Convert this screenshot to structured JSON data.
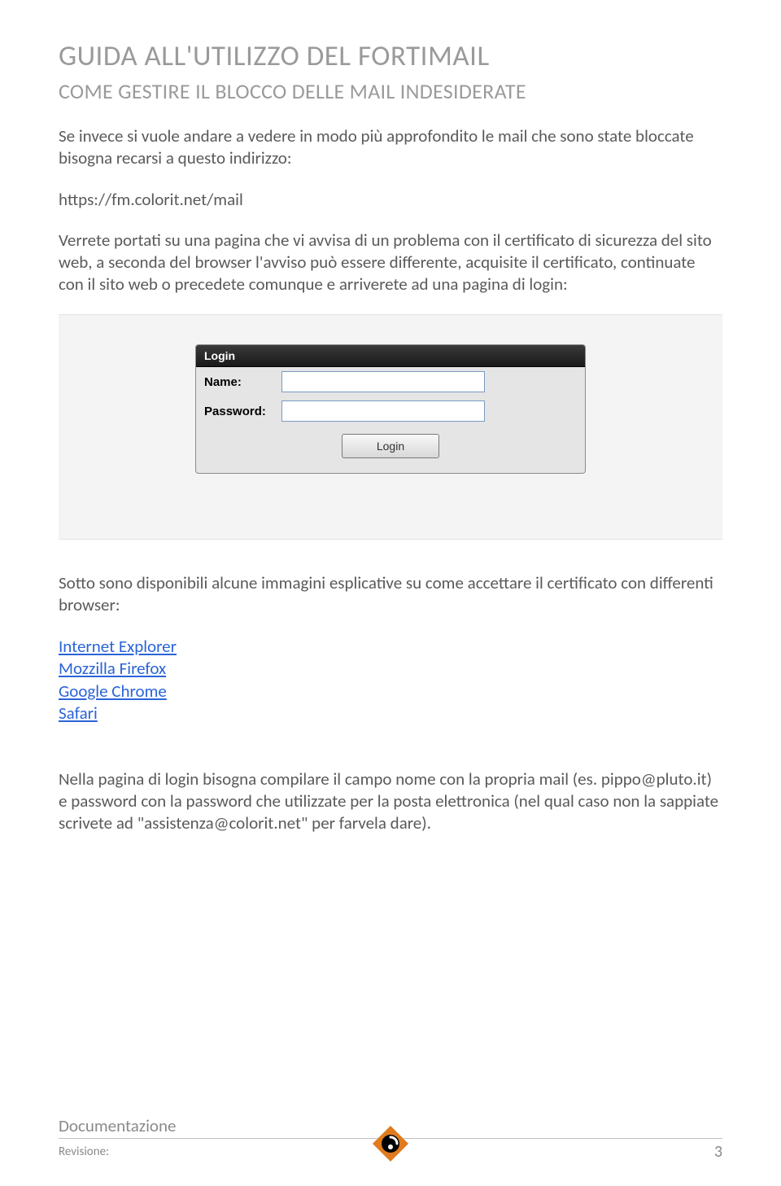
{
  "header": {
    "title": "GUIDA ALL'UTILIZZO DEL FORTIMAIL",
    "subtitle": "COME GESTIRE IL BLOCCO DELLE MAIL INDESIDERATE"
  },
  "paragraphs": {
    "intro": "Se invece si vuole andare a vedere in modo più approfondito le mail che sono state bloccate bisogna recarsi a questo indirizzo:",
    "url": "https://fm.colorit.net/mail",
    "afterUrl": "Verrete portati su una pagina che vi avvisa di un problema con il certificato di sicurezza del sito web, a seconda del browser l'avviso può essere differente, acquisite il certificato, continuate con il sito web o precedete comunque e arriverete ad una pagina di login:",
    "belowImage": "Sotto sono disponibili alcune immagini esplicative su come accettare il certificato con differenti browser:",
    "final": "Nella pagina di login bisogna compilare il campo nome con la propria mail (es. pippo@pluto.it) e password con la password che utilizzate per la posta elettronica (nel qual caso non la sappiate scrivete ad \"assistenza@colorit.net\" per farvela dare)."
  },
  "loginBox": {
    "header": "Login",
    "nameLabel": "Name:",
    "passwordLabel": "Password:",
    "nameValue": "",
    "passwordValue": "",
    "button": "Login"
  },
  "links": [
    "Internet Explorer",
    "Mozzilla Firefox",
    "Google Chrome",
    "Safari"
  ],
  "footer": {
    "section": "Documentazione",
    "revision": "Revisione:",
    "page": "3"
  }
}
